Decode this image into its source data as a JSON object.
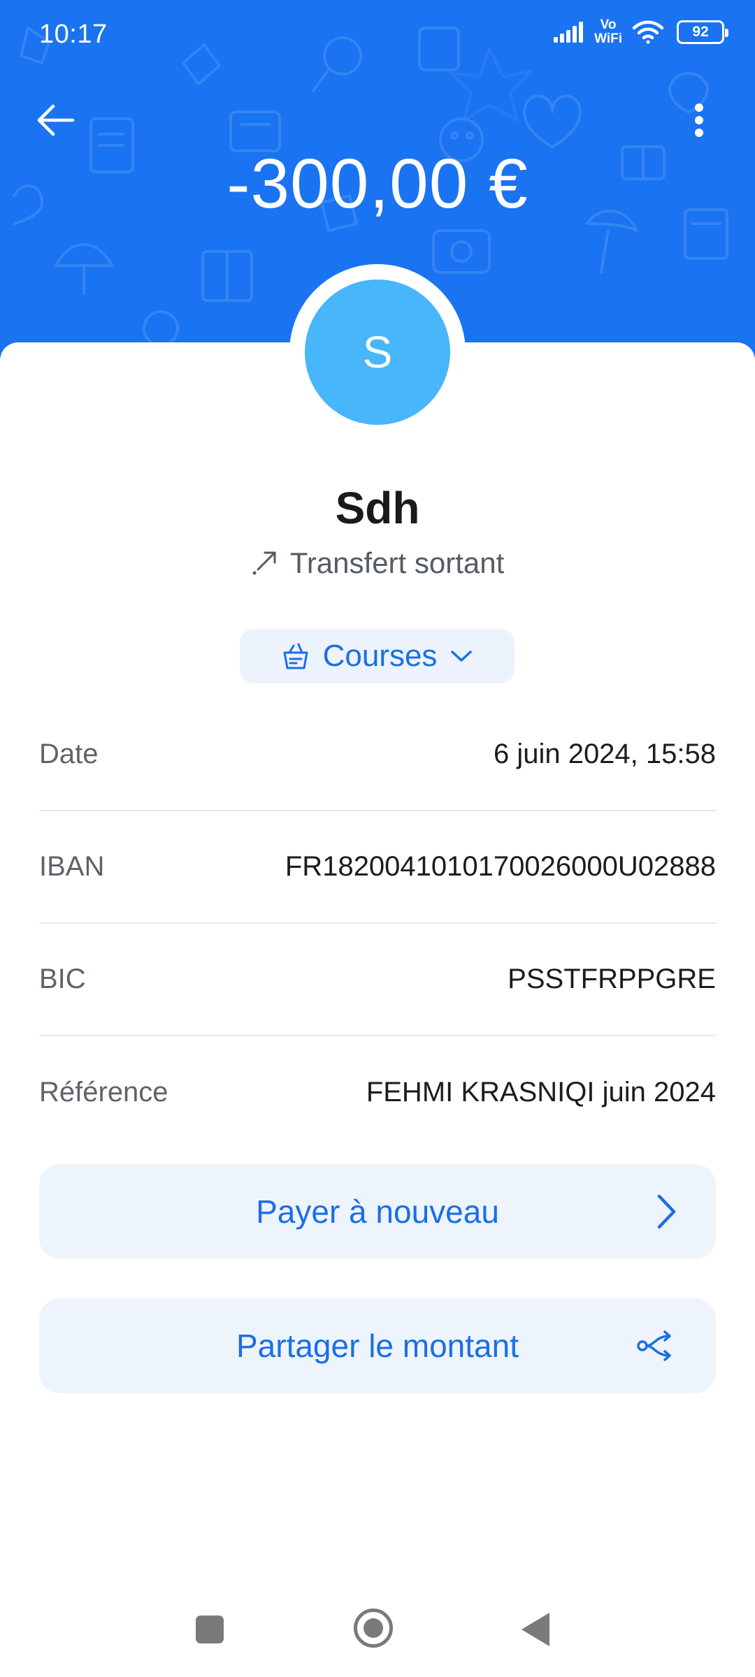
{
  "status_bar": {
    "time": "10:17",
    "vowifi_top": "Vo",
    "vowifi_bottom": "WiFi",
    "battery": "92"
  },
  "header": {
    "amount": "-300,00 €",
    "back_icon": "arrow-left-icon",
    "menu_icon": "more-vertical-icon",
    "background_color": "#1a73f0"
  },
  "recipient": {
    "avatar_initial": "S",
    "avatar_color": "#47b6fa",
    "name": "Sdh",
    "transaction_type": "Transfert sortant",
    "type_icon": "arrow-up-right-icon"
  },
  "category": {
    "label": "Courses",
    "icon": "grocery-basket-icon",
    "dropdown_icon": "chevron-down-icon"
  },
  "details": [
    {
      "label": "Date",
      "value": "6 juin 2024, 15:58"
    },
    {
      "label": "IBAN",
      "value": "FR1820041010170026000U02888"
    },
    {
      "label": "BIC",
      "value": "PSSTFRPPGRE"
    },
    {
      "label": "Référence",
      "value": "FEHMI KRASNIQI juin 2024"
    }
  ],
  "actions": {
    "pay_again": {
      "label": "Payer à nouveau",
      "icon": "chevron-right-icon"
    },
    "share_amount": {
      "label": "Partager le montant",
      "icon": "split-share-icon"
    }
  },
  "accent_color": "#1a6fe6"
}
